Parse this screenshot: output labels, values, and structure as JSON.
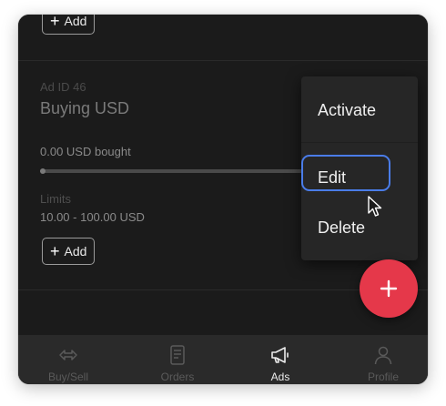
{
  "top_add_label": "Add",
  "ad": {
    "id_label": "Ad ID 46",
    "title": "Buying USD",
    "bought": "0.00 USD bought",
    "progress": 0.0,
    "limits_label": "Limits",
    "limits_value": "10.00 - 100.00 USD",
    "add_label": "Add"
  },
  "menu": {
    "items": [
      {
        "label": "Activate"
      },
      {
        "label": "Edit"
      },
      {
        "label": "Delete"
      }
    ]
  },
  "fab": {
    "icon": "plus-icon"
  },
  "nav": {
    "items": [
      {
        "label": "Buy/Sell",
        "icon": "swap-arrows-icon",
        "active": false
      },
      {
        "label": "Orders",
        "icon": "document-icon",
        "active": false
      },
      {
        "label": "Ads",
        "icon": "megaphone-icon",
        "active": true
      },
      {
        "label": "Profile",
        "icon": "person-icon",
        "active": false
      }
    ]
  },
  "colors": {
    "background": "#1b1b1b",
    "fab": "#e5384a",
    "focus_ring": "#4a7ce8",
    "nav_bg": "#2a2a2a"
  }
}
